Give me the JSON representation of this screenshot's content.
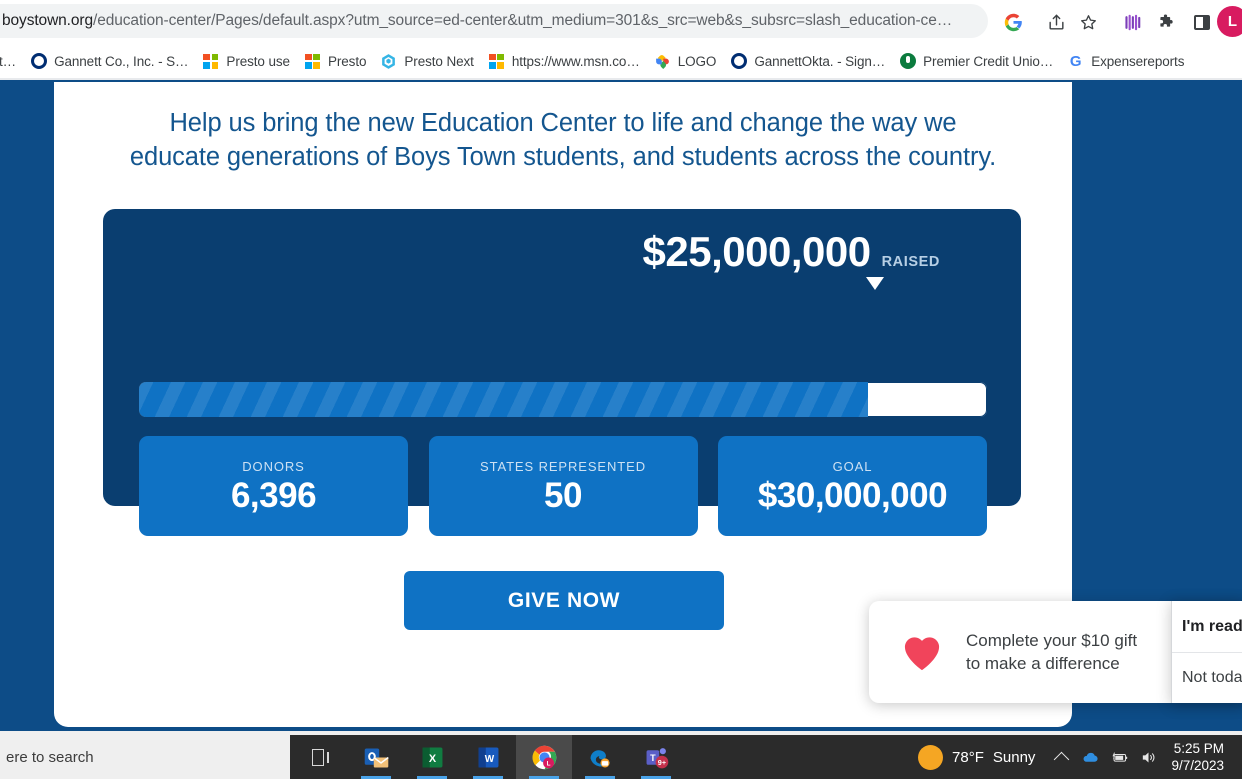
{
  "browser": {
    "url_prefix": "boystown.org",
    "url_rest": "/education-center/Pages/default.aspx?utm_source=ed-center&utm_medium=301&s_src=web&s_subsrc=slash_education-ce…",
    "toolbar_icons": [
      {
        "name": "google-icon",
        "label": "G"
      },
      {
        "name": "share-icon",
        "label": "Share"
      },
      {
        "name": "bookmark-star-icon",
        "label": "Bookmark this tab"
      },
      {
        "name": "extension-purple-icon",
        "label": "Extension"
      },
      {
        "name": "extensions-puzzle-icon",
        "label": "Extensions"
      },
      {
        "name": "side-panel-icon",
        "label": "Side panel"
      }
    ],
    "profile_initial": "L",
    "bookmarks": [
      {
        "label": "t…",
        "icon": "truncated-bookmark-icon"
      },
      {
        "label": "Gannett Co., Inc. - S…",
        "icon": "okta-ring-icon"
      },
      {
        "label": "Presto use",
        "icon": "microsoft-icon"
      },
      {
        "label": "Presto",
        "icon": "microsoft-icon"
      },
      {
        "label": "Presto Next",
        "icon": "hexagon-icon"
      },
      {
        "label": "https://www.msn.co…",
        "icon": "microsoft-icon"
      },
      {
        "label": "LOGO",
        "icon": "google-photos-icon"
      },
      {
        "label": "GannettOkta. - Sign…",
        "icon": "okta-ring-icon"
      },
      {
        "label": "Premier Credit Unio…",
        "icon": "credit-union-icon"
      },
      {
        "label": "Expensereports",
        "icon": "google-g-icon"
      }
    ]
  },
  "page": {
    "headline_line1": "Help us bring the new Education Center to life and change the way we",
    "headline_line2": "educate generations of Boys Town students, and students across the country.",
    "fundraiser": {
      "raised_amount": "$25,000,000",
      "raised_label": "RAISED",
      "progress_percent": 86,
      "stats": [
        {
          "label": "DONORS",
          "value": "6,396"
        },
        {
          "label": "STATES REPRESENTED",
          "value": "50"
        },
        {
          "label": "GOAL",
          "value": "$30,000,000"
        }
      ]
    },
    "cta_button": "GIVE NOW",
    "nudge": {
      "message": "Complete your $10 gift\nto make a difference",
      "primary_action": "I'm read",
      "secondary_action": "Not toda"
    },
    "colors": {
      "page_background": "#0d4c87",
      "panel_background": "#0a3e70",
      "accent_blue": "#0f72c4",
      "headline_blue": "#14568f",
      "heart_red": "#f1445b"
    }
  },
  "taskbar": {
    "search_placeholder": "ere to search",
    "items": [
      {
        "name": "task-view-icon",
        "label": "Task View"
      },
      {
        "name": "outlook-icon",
        "label": "Outlook"
      },
      {
        "name": "excel-icon",
        "label": "Excel"
      },
      {
        "name": "word-icon",
        "label": "Word"
      },
      {
        "name": "chrome-icon",
        "label": "Google Chrome"
      },
      {
        "name": "edge-icon",
        "label": "Microsoft Edge"
      },
      {
        "name": "teams-icon",
        "label": "Microsoft Teams"
      }
    ],
    "teams_badge": "9+",
    "weather_temp": "78°F",
    "weather_condition": "Sunny",
    "time": "5:25 PM",
    "date": "9/7/2023"
  }
}
